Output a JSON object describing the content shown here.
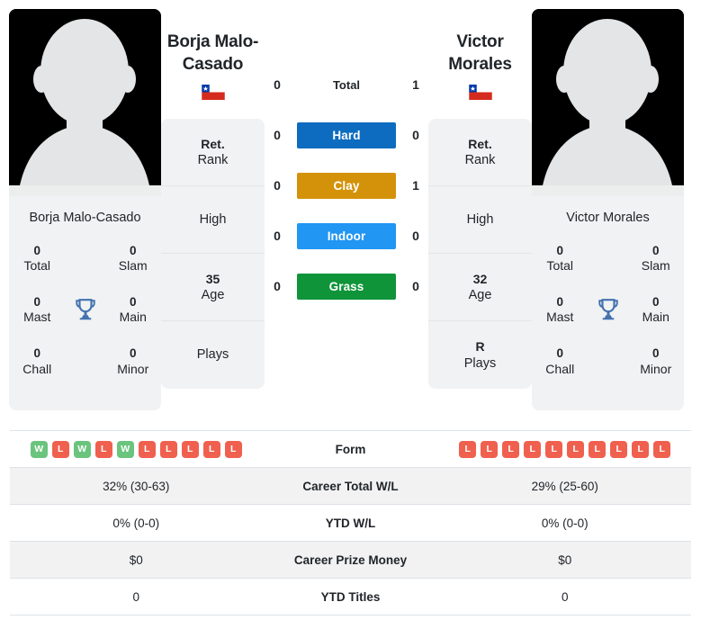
{
  "players": {
    "left": {
      "name": "Borja Malo-Casado",
      "display_name": "Borja Malo-Casado",
      "flag": "chile-flag-icon",
      "photo": "player-silhouette-placeholder",
      "titles": [
        {
          "value": "0",
          "label": "Total"
        },
        {
          "value": "0",
          "label": "Slam"
        },
        {
          "value": "0",
          "label": "Mast"
        },
        {
          "value": "0",
          "label": "Main"
        },
        {
          "value": "0",
          "label": "Chall"
        },
        {
          "value": "0",
          "label": "Minor"
        }
      ],
      "info": [
        {
          "value": "Ret.",
          "label": "Rank"
        },
        {
          "value": "",
          "label": "High"
        },
        {
          "value": "35",
          "label": "Age"
        },
        {
          "value": "",
          "label": "Plays"
        }
      ]
    },
    "right": {
      "name": "Victor Morales",
      "display_name": "Victor Morales",
      "flag": "chile-flag-icon",
      "photo": "player-silhouette-placeholder",
      "titles": [
        {
          "value": "0",
          "label": "Total"
        },
        {
          "value": "0",
          "label": "Slam"
        },
        {
          "value": "0",
          "label": "Mast"
        },
        {
          "value": "0",
          "label": "Main"
        },
        {
          "value": "0",
          "label": "Chall"
        },
        {
          "value": "0",
          "label": "Minor"
        }
      ],
      "info": [
        {
          "value": "Ret.",
          "label": "Rank"
        },
        {
          "value": "",
          "label": "High"
        },
        {
          "value": "32",
          "label": "Age"
        },
        {
          "value": "R",
          "label": "Plays"
        }
      ]
    }
  },
  "head_to_head": {
    "total": {
      "label": "Total",
      "left": "0",
      "right": "1"
    },
    "surfaces": [
      {
        "label": "Hard",
        "left": "0",
        "right": "0",
        "color": "#0d6cbf"
      },
      {
        "label": "Clay",
        "left": "0",
        "right": "1",
        "color": "#d4920a"
      },
      {
        "label": "Indoor",
        "left": "0",
        "right": "0",
        "color": "#2196f3"
      },
      {
        "label": "Grass",
        "left": "0",
        "right": "0",
        "color": "#0f9439"
      }
    ]
  },
  "stats_table": {
    "form": {
      "label": "Form",
      "left": [
        "W",
        "L",
        "W",
        "L",
        "W",
        "L",
        "L",
        "L",
        "L",
        "L"
      ],
      "right": [
        "L",
        "L",
        "L",
        "L",
        "L",
        "L",
        "L",
        "L",
        "L",
        "L"
      ]
    },
    "rows": [
      {
        "label": "Career Total W/L",
        "left": "32% (30-63)",
        "right": "29% (25-60)"
      },
      {
        "label": "YTD W/L",
        "left": "0% (0-0)",
        "right": "0% (0-0)"
      },
      {
        "label": "Career Prize Money",
        "left": "$0",
        "right": "$0"
      },
      {
        "label": "YTD Titles",
        "left": "0",
        "right": "0"
      }
    ]
  },
  "colors": {
    "win": "#6ac47e",
    "loss": "#f0604f",
    "card_bg": "#f1f2f3",
    "row_shade": "#f2f2f3"
  }
}
